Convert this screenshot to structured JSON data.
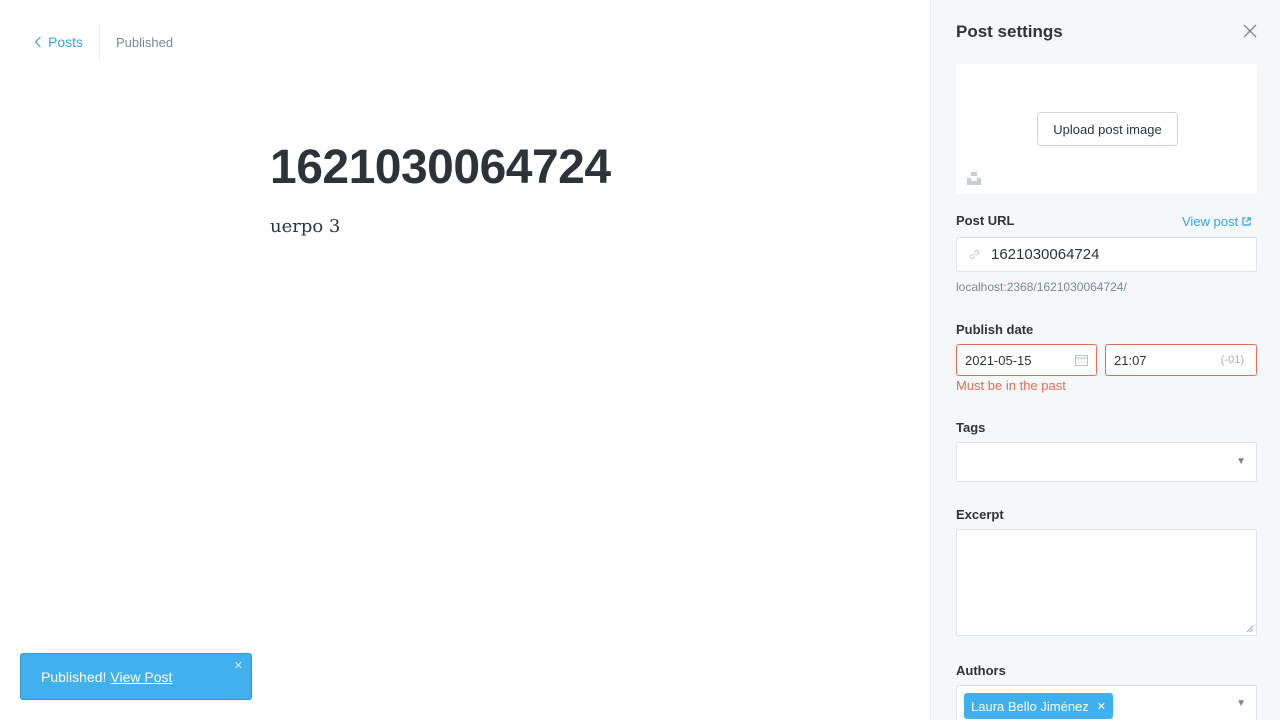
{
  "nav": {
    "back_label": "Posts",
    "status": "Published"
  },
  "post": {
    "title": "1621030064724",
    "body": "uerpo 3"
  },
  "toast": {
    "message": "Published!",
    "link_label": "View Post",
    "close": "✕"
  },
  "settings": {
    "title": "Post settings",
    "upload_label": "Upload post image",
    "post_url": {
      "label": "Post URL",
      "view_post": "View post",
      "value": "1621030064724",
      "hint": "localhost:2368/1621030064724/"
    },
    "publish_date": {
      "label": "Publish date",
      "date": "2021-05-15",
      "time": "21:07",
      "tz": "(-01)",
      "error": "Must be in the past"
    },
    "tags": {
      "label": "Tags",
      "caret": "▼"
    },
    "excerpt": {
      "label": "Excerpt"
    },
    "authors": {
      "label": "Authors",
      "items": [
        "Laura Bello Jiménez"
      ],
      "remove": "✕",
      "caret": "▼"
    }
  },
  "colors": {
    "accent": "#30a5d8",
    "error": "#e16e54",
    "toast_bg": "#40b0ee"
  }
}
